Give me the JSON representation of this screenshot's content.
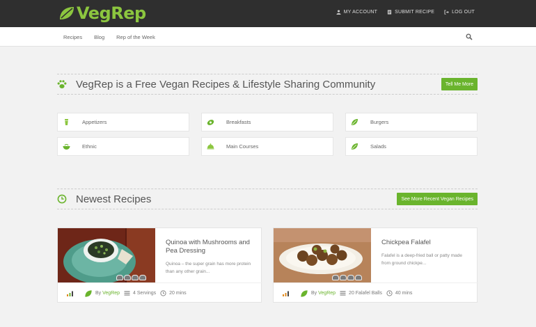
{
  "brand": {
    "name": "VegRep",
    "accent": "#8cc63f",
    "button_green": "#6ab42d"
  },
  "top_nav": {
    "links": [
      {
        "label": "MY ACCOUNT",
        "icon": "user-icon"
      },
      {
        "label": "SUBMIT RECIPE",
        "icon": "document-icon"
      },
      {
        "label": "LOG OUT",
        "icon": "logout-icon"
      }
    ]
  },
  "main_nav": {
    "items": [
      "Recipes",
      "Blog",
      "Rep of the Week"
    ],
    "search_icon": "search-icon"
  },
  "intro": {
    "title": "VegRep is a Free Vegan Recipes & Lifestyle Sharing Community",
    "button": "Tell Me More",
    "icon": "paw-icon"
  },
  "categories": [
    {
      "label": "Appetizers",
      "icon": "glass-icon"
    },
    {
      "label": "Breakfasts",
      "icon": "egg-icon"
    },
    {
      "label": "Burgers",
      "icon": "leaf-icon"
    },
    {
      "label": "Ethnic",
      "icon": "bowl-icon"
    },
    {
      "label": "Main Courses",
      "icon": "cloche-icon"
    },
    {
      "label": "Salads",
      "icon": "leaf-icon"
    }
  ],
  "newest": {
    "title": "Newest Recipes",
    "button": "See More Recent Vegan Recipes",
    "icon": "clock-icon"
  },
  "recipes": [
    {
      "title": "Quinoa with Mushrooms and Pea Dressing",
      "description": "Quinoa – the super grain has more protein than any other grain...",
      "by_prefix": "By",
      "author": "VegRep",
      "servings": "4 Servings",
      "time": "20 mins"
    },
    {
      "title": "Chickpea Falafel",
      "description": "Falafel is a deep-fried ball or patty made from ground chickpe...",
      "by_prefix": "By",
      "author": "VegRep",
      "servings": "20 Falafel Balls",
      "time": "40 mins"
    }
  ]
}
